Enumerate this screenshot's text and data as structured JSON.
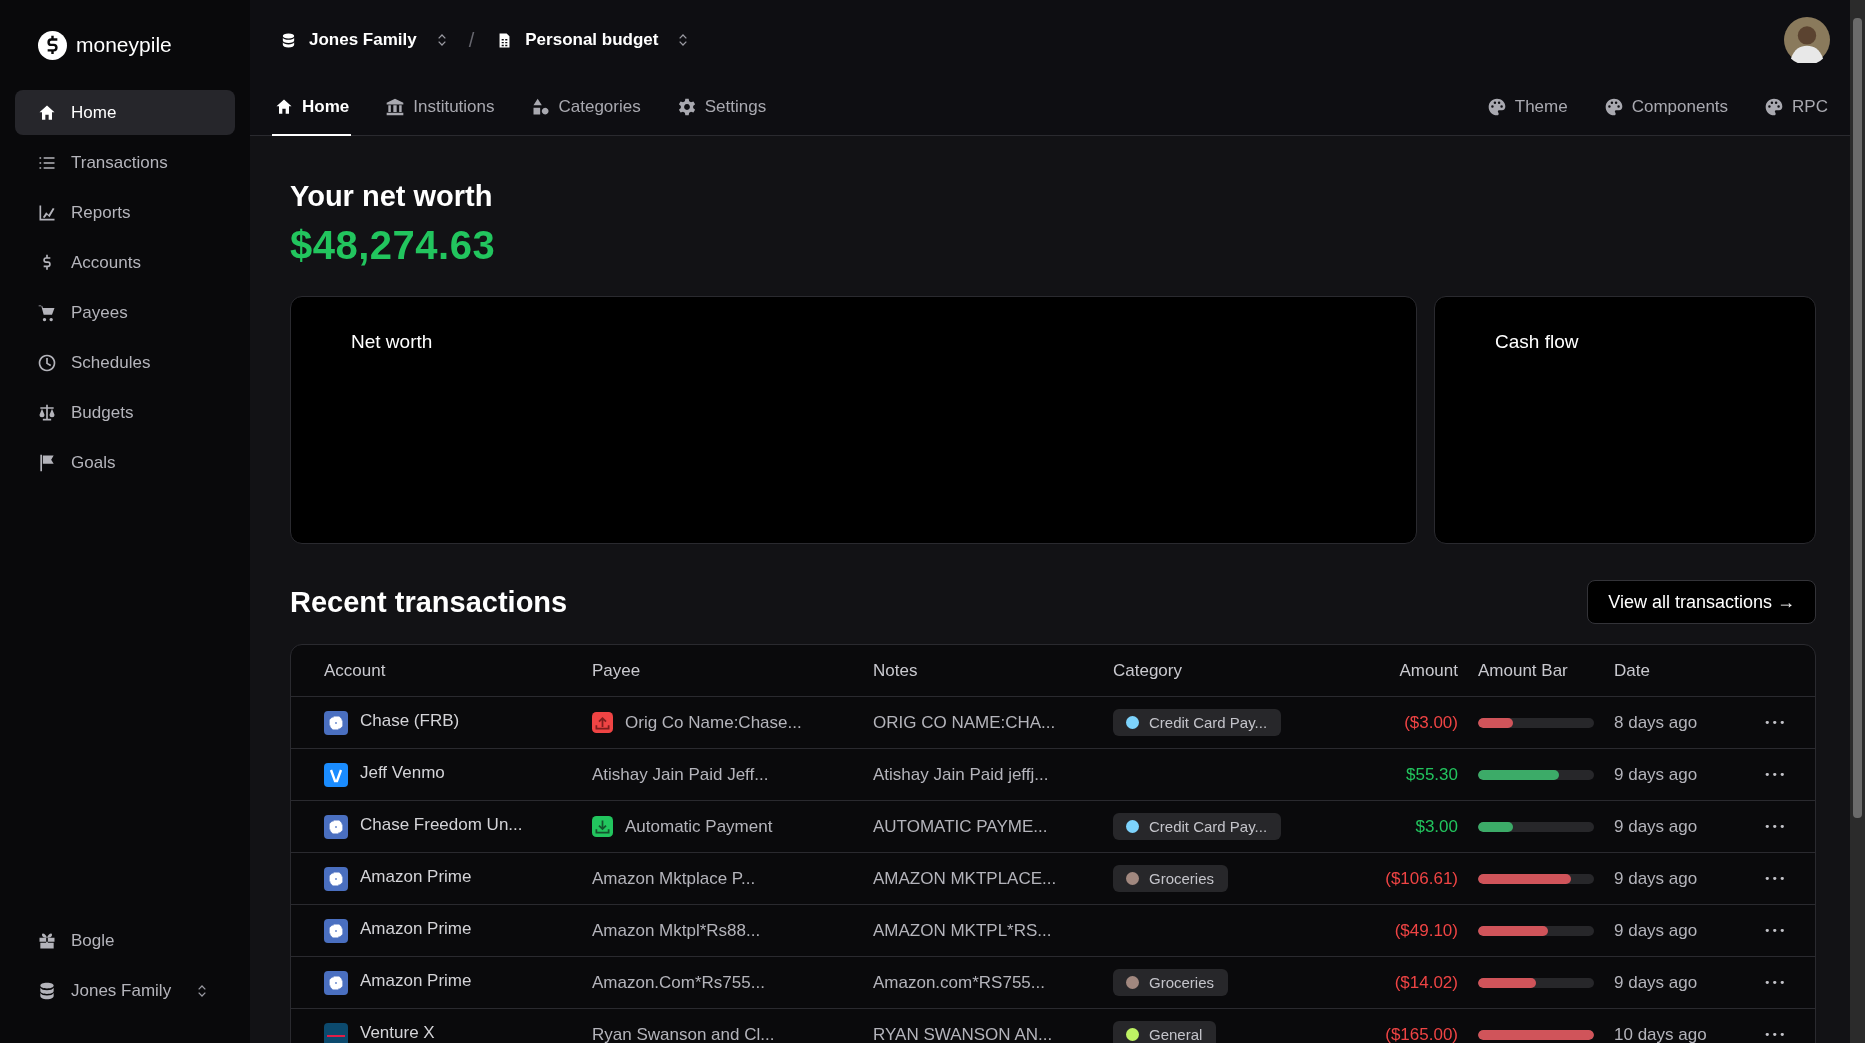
{
  "brand": {
    "name": "moneypile"
  },
  "sidebar": {
    "items": [
      {
        "label": "Home",
        "selected": true
      },
      {
        "label": "Transactions",
        "selected": false
      },
      {
        "label": "Reports",
        "selected": false
      },
      {
        "label": "Accounts",
        "selected": false
      },
      {
        "label": "Payees",
        "selected": false
      },
      {
        "label": "Schedules",
        "selected": false
      },
      {
        "label": "Budgets",
        "selected": false
      },
      {
        "label": "Goals",
        "selected": false
      }
    ],
    "footer": [
      {
        "label": "Bogle"
      },
      {
        "label": "Jones Family"
      }
    ]
  },
  "breadcrumb": [
    {
      "label": "Jones Family"
    },
    {
      "label": "Personal budget"
    }
  ],
  "separator": "/",
  "tabs": [
    {
      "label": "Home",
      "selected": true
    },
    {
      "label": "Institutions",
      "selected": false
    },
    {
      "label": "Categories",
      "selected": false
    },
    {
      "label": "Settings",
      "selected": false
    }
  ],
  "tools": [
    {
      "label": "Theme"
    },
    {
      "label": "Components"
    },
    {
      "label": "RPC"
    }
  ],
  "net_worth": {
    "title": "Your net worth",
    "value": "$48,274.63"
  },
  "cards": [
    {
      "title": "Net worth"
    },
    {
      "title": "Cash flow"
    }
  ],
  "recent": {
    "title": "Recent transactions",
    "button": "View all transactions →",
    "columns": [
      "Account",
      "Payee",
      "Notes",
      "Category",
      "Amount",
      "Amount Bar",
      "Date"
    ],
    "rows": [
      {
        "account": "Chase (FRB)",
        "payee": "Orig Co Name:Chase...",
        "notes": "ORIG CO NAME:CHA...",
        "category": {
          "label": "Credit Card Pay...",
          "color": "#7dd3fc"
        },
        "amount": "($3.00)",
        "kind": "outflow",
        "level": 0.3,
        "date": "8 days ago",
        "menu": "•••"
      },
      {
        "account": "Jeff Venmo",
        "payee": "Atishay Jain Paid Jeff...",
        "notes": "Atishay Jain Paid jeffj...",
        "amount": "$55.30",
        "kind": "inflow",
        "level": 0.7,
        "date": "9 days ago",
        "menu": "•••"
      },
      {
        "account": "Chase Freedom Un...",
        "payee": "Automatic Payment",
        "notes": "AUTOMATIC PAYME...",
        "category": {
          "label": "Credit Card Pay...",
          "color": "#7dd3fc"
        },
        "amount": "$3.00",
        "kind": "inflow",
        "level": 0.3,
        "date": "9 days ago",
        "menu": "•••"
      },
      {
        "account": "Amazon Prime",
        "payee": "Amazon Mktplace P...",
        "notes": "AMAZON MKTPLACE...",
        "category": {
          "label": "Groceries",
          "color": "#a1887f"
        },
        "amount": "($106.61)",
        "kind": "outflow",
        "level": 0.8,
        "date": "9 days ago",
        "menu": "•••"
      },
      {
        "account": "Amazon Prime",
        "payee": "Amazon Mktpl*Rs88...",
        "notes": "AMAZON MKTPL*RS...",
        "amount": "($49.10)",
        "kind": "outflow",
        "level": 0.6,
        "date": "9 days ago",
        "menu": "•••"
      },
      {
        "account": "Amazon Prime",
        "payee": "Amazon.Com*Rs755...",
        "notes": "Amazon.com*RS755...",
        "category": {
          "label": "Groceries",
          "color": "#a1887f"
        },
        "amount": "($14.02)",
        "kind": "outflow",
        "level": 0.5,
        "date": "9 days ago",
        "menu": "•••"
      },
      {
        "account": "Venture X",
        "payee": "Ryan Swanson and Cl...",
        "notes": "RYAN SWANSON AN...",
        "category": {
          "label": "General",
          "color": "#bef264"
        },
        "amount": "($165.00)",
        "kind": "outflow",
        "level": 1.0,
        "date": "10 days ago",
        "menu": "•••"
      }
    ]
  }
}
